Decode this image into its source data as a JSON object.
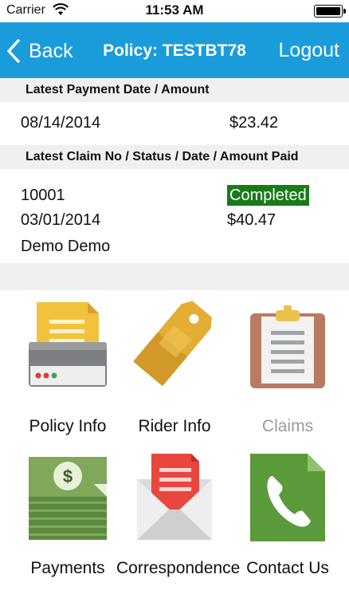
{
  "status_bar": {
    "carrier": "Carrier",
    "time": "11:53 AM",
    "wifi_icon": "wifi-icon",
    "battery_icon": "battery-icon"
  },
  "nav": {
    "back_label": "Back",
    "title": "Policy: TESTBT78",
    "logout_label": "Logout",
    "bar_color": "#1a9cdb"
  },
  "payment": {
    "header": "Latest Payment Date / Amount",
    "date": "08/14/2014",
    "amount": "$23.42"
  },
  "claim": {
    "header": "Latest Claim No / Status / Date / Amount Paid",
    "number": "10001",
    "status": "Completed",
    "status_color": "#1a7a1a",
    "date": "03/01/2014",
    "amount_paid": "$40.47",
    "name": "Demo Demo"
  },
  "menu": [
    {
      "label": "Policy Info",
      "icon": "printer-document-icon",
      "enabled": true
    },
    {
      "label": "Rider Info",
      "icon": "price-tag-icon",
      "enabled": true
    },
    {
      "label": "Claims",
      "icon": "clipboard-icon",
      "enabled": false
    },
    {
      "label": "Payments",
      "icon": "money-stack-icon",
      "enabled": true
    },
    {
      "label": "Correspondence",
      "icon": "envelope-letter-icon",
      "enabled": true
    },
    {
      "label": "Contact Us",
      "icon": "phone-icon",
      "enabled": true
    }
  ]
}
